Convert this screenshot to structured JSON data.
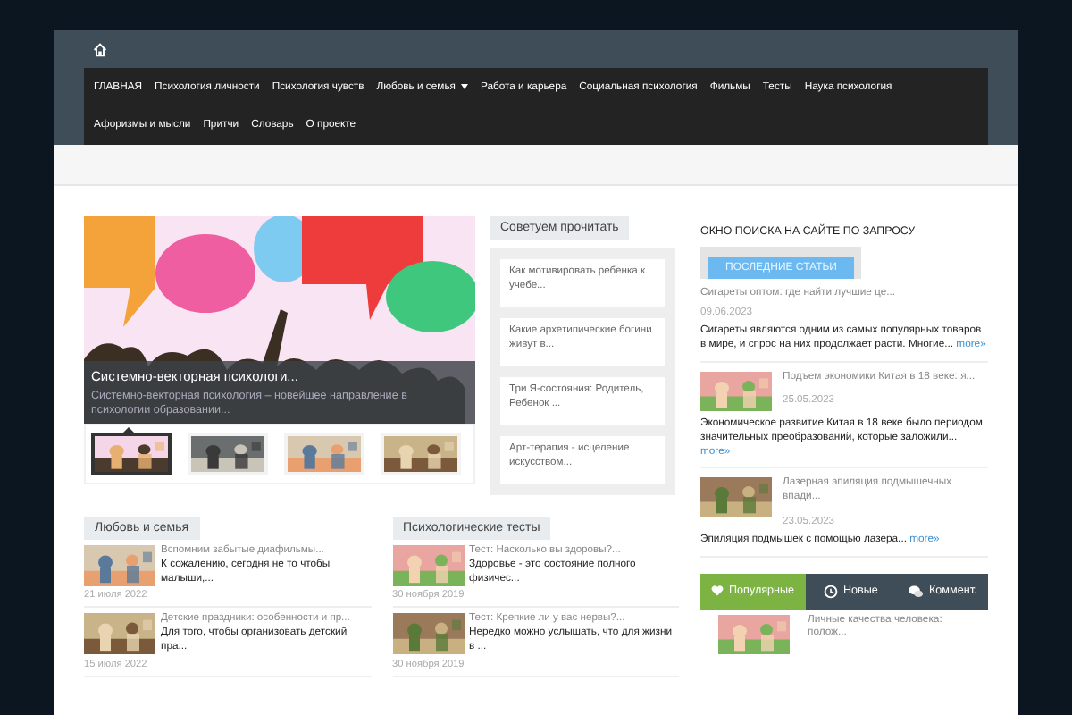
{
  "nav": [
    {
      "label": "ГЛАВНАЯ",
      "dropdown": false
    },
    {
      "label": "Психология личности",
      "dropdown": false
    },
    {
      "label": "Психология чувств",
      "dropdown": false
    },
    {
      "label": "Любовь и семья",
      "dropdown": true
    },
    {
      "label": "Работа и карьера",
      "dropdown": false
    },
    {
      "label": "Социальная психология",
      "dropdown": false
    },
    {
      "label": "Фильмы",
      "dropdown": false
    },
    {
      "label": "Тесты",
      "dropdown": false
    },
    {
      "label": "Наука психология",
      "dropdown": false
    },
    {
      "label": "Афоризмы и мысли",
      "dropdown": false
    },
    {
      "label": "Притчи",
      "dropdown": false
    },
    {
      "label": "Словарь",
      "dropdown": false
    },
    {
      "label": "О проекте",
      "dropdown": false
    }
  ],
  "slider": {
    "title": "Системно-векторная психологи...",
    "text": "Системно-векторная психология – новейшее направление в психологии образовании...",
    "thumbs": [
      {
        "selected": true
      },
      {
        "selected": false
      },
      {
        "selected": false
      },
      {
        "selected": false
      }
    ]
  },
  "recommend": {
    "heading": "Советуем прочитать",
    "items": [
      "Как мотивировать ребенка к учебе...",
      "Какие архетипические богини живут в...",
      "Три Я-состояния: Родитель, Ребенок ...",
      "Арт-терапия - исцеление искусством..."
    ]
  },
  "sections": [
    {
      "heading": "Любовь и семья",
      "posts": [
        {
          "title": "Вспомним забытые диафильмы...",
          "excerpt": "К сожалению, сегодня не то чтобы малыши,...",
          "date": "21 июля 2022"
        },
        {
          "title": "Детские праздники: особенности и пр...",
          "excerpt": "Для того, чтобы организовать детский пра...",
          "date": "15 июля 2022"
        }
      ]
    },
    {
      "heading": "Психологические тесты",
      "posts": [
        {
          "title": "Тест: Насколько вы здоровы?...",
          "excerpt": "Здоровье - это состояние полного физичес...",
          "date": "30 ноября 2019"
        },
        {
          "title": "Тест: Крепкие ли у вас нервы?...",
          "excerpt": "Нередко можно услышать, что для жизни в ...",
          "date": "30 ноября 2019"
        }
      ]
    }
  ],
  "sidebar": {
    "search_title": "ОКНО ПОИСКА НА САЙТЕ ПО ЗАПРОСУ",
    "latest_button": "ПОСЛЕДНИЕ СТАТЬИ",
    "articles": [
      {
        "kind": "plain",
        "title": "Сигареты оптом: где найти лучшие це...",
        "date": "09.06.2023",
        "excerpt": "Сигареты являются одним из самых популярных товаров в мире, и спрос на них продолжает расти. Многие...",
        "more": "more»"
      },
      {
        "kind": "thumb",
        "title": "Подъем экономики Китая в 18 веке: я...",
        "date": "25.05.2023",
        "excerpt": "Экономическое развитие Китая в 18 веке было периодом значительных преобразований, которые заложили...",
        "more": "more»"
      },
      {
        "kind": "thumb",
        "title": "Лазерная эпиляция подмышечных впади...",
        "date": "23.05.2023",
        "excerpt": "Эпиляция подмышек с помощью лазера...",
        "more": "more»"
      }
    ],
    "tabs": [
      {
        "label": "Популярные",
        "selected": true
      },
      {
        "label": "Новые",
        "selected": false
      },
      {
        "label": "Коммент.",
        "selected": false
      }
    ],
    "popular": [
      {
        "title": "Личные качества человека: полож..."
      }
    ]
  }
}
